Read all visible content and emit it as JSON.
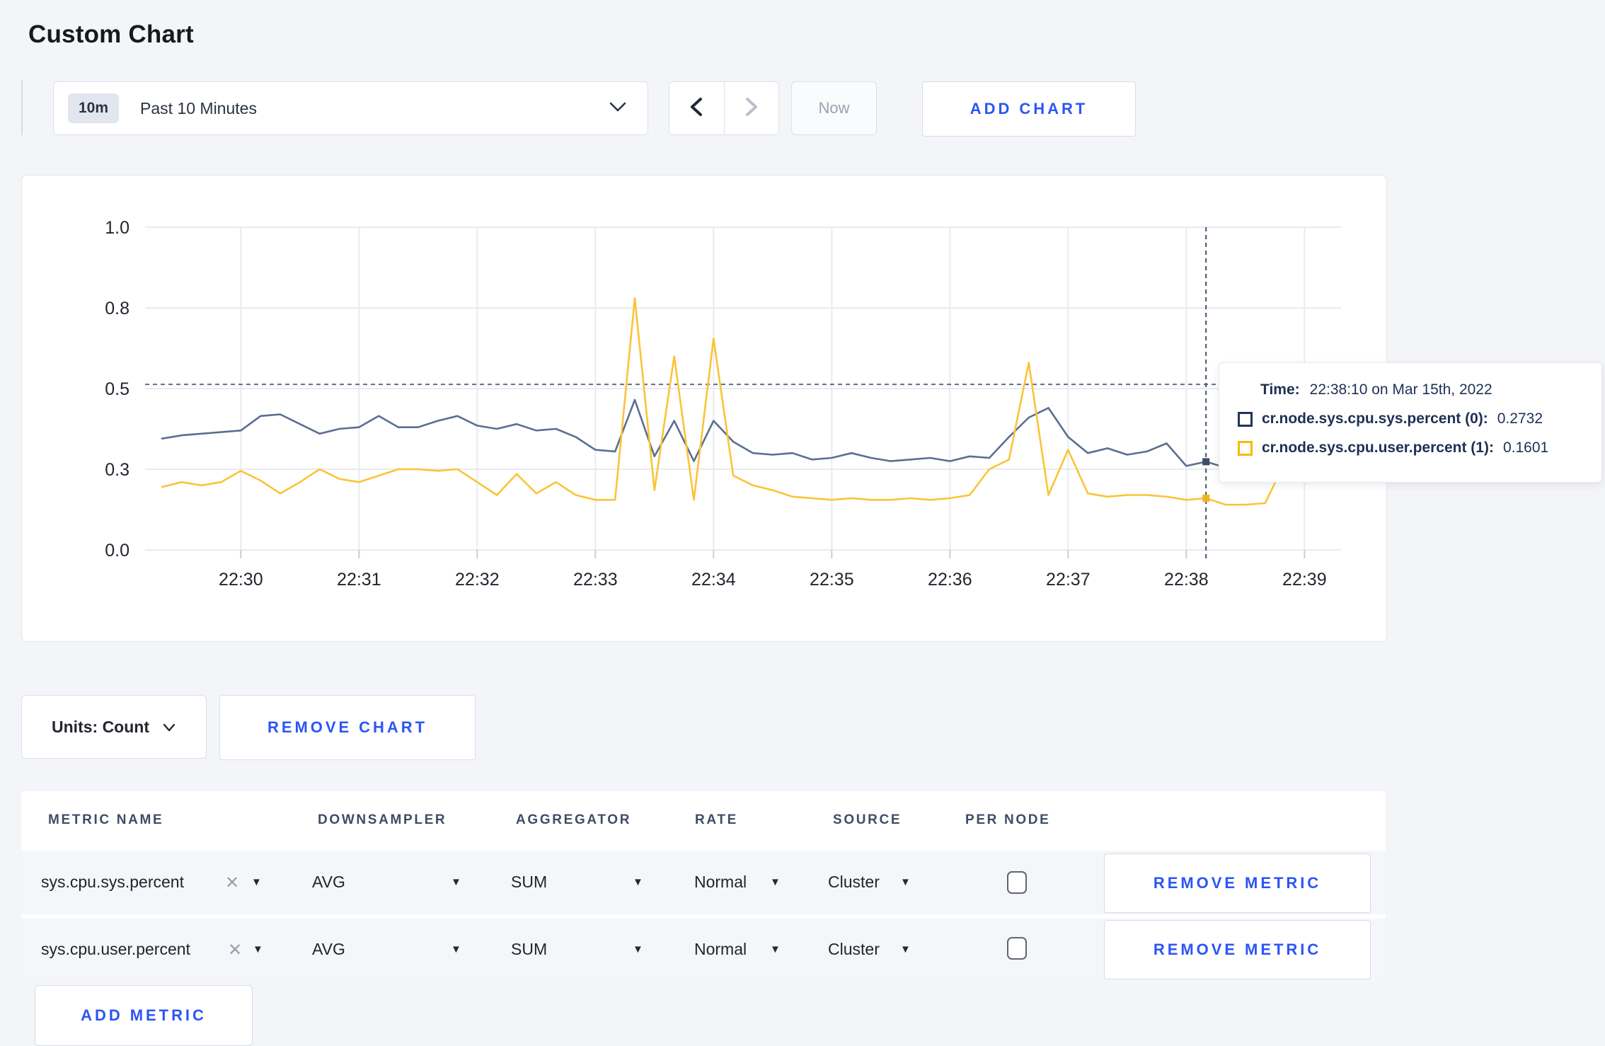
{
  "page": {
    "title": "Custom Chart"
  },
  "toolbar": {
    "time_badge": "10m",
    "time_label": "Past 10 Minutes",
    "now_label": "Now",
    "add_chart_label": "ADD CHART",
    "accent_color": "#2b55f6"
  },
  "chart_controls": {
    "units_label": "Units: Count",
    "remove_chart_label": "REMOVE CHART"
  },
  "metrics_table": {
    "headers": [
      "METRIC NAME",
      "DOWNSAMPLER",
      "AGGREGATOR",
      "RATE",
      "SOURCE",
      "PER NODE"
    ],
    "remove_metric_label": "REMOVE METRIC",
    "add_metric_label": "ADD METRIC",
    "remove_icon": "✕",
    "caret_icon": "▼",
    "rows": [
      {
        "metric": "sys.cpu.sys.percent",
        "downsampler": "AVG",
        "aggregator": "SUM",
        "rate": "Normal",
        "source": "Cluster",
        "per_node_checked": false
      },
      {
        "metric": "sys.cpu.user.percent",
        "downsampler": "AVG",
        "aggregator": "SUM",
        "rate": "Normal",
        "source": "Cluster",
        "per_node_checked": false
      }
    ]
  },
  "chart_data": {
    "type": "line",
    "title": "",
    "xlabel": "",
    "ylabel": "",
    "ylim": [
      0,
      1
    ],
    "grid": true,
    "x_start_time": "22:29:20",
    "x_interval_seconds": 10,
    "x_tick_labels": [
      "22:30",
      "22:31",
      "22:32",
      "22:33",
      "22:34",
      "22:35",
      "22:36",
      "22:37",
      "22:38",
      "22:39"
    ],
    "y_tick_labels": [
      "0.0",
      "0.3",
      "0.5",
      "0.8",
      "1.0"
    ],
    "y_tick_values": [
      0,
      0.25,
      0.5,
      0.75,
      1
    ],
    "series": [
      {
        "name": "cr.node.sys.cpu.sys.percent",
        "color": "#5b6e91",
        "dot_color": "#3d4d66",
        "values": [
          0.345,
          0.355,
          0.36,
          0.365,
          0.37,
          0.415,
          0.42,
          0.39,
          0.36,
          0.375,
          0.38,
          0.415,
          0.38,
          0.38,
          0.4,
          0.415,
          0.385,
          0.375,
          0.39,
          0.37,
          0.375,
          0.35,
          0.31,
          0.305,
          0.465,
          0.29,
          0.4,
          0.275,
          0.4,
          0.335,
          0.3,
          0.295,
          0.3,
          0.28,
          0.285,
          0.3,
          0.285,
          0.275,
          0.28,
          0.285,
          0.275,
          0.29,
          0.285,
          0.35,
          0.41,
          0.44,
          0.35,
          0.3,
          0.315,
          0.295,
          0.305,
          0.33,
          0.26,
          0.2732,
          0.255,
          0.26,
          0.27,
          0.28,
          0.285,
          0.28
        ]
      },
      {
        "name": "cr.node.sys.cpu.user.percent",
        "color": "#fbc437",
        "dot_color": "#f2b31d",
        "values": [
          0.195,
          0.21,
          0.2,
          0.21,
          0.245,
          0.215,
          0.175,
          0.21,
          0.25,
          0.22,
          0.21,
          0.23,
          0.25,
          0.25,
          0.245,
          0.25,
          0.21,
          0.17,
          0.235,
          0.175,
          0.21,
          0.17,
          0.155,
          0.155,
          0.78,
          0.185,
          0.6,
          0.155,
          0.655,
          0.23,
          0.2,
          0.185,
          0.165,
          0.16,
          0.155,
          0.16,
          0.155,
          0.155,
          0.16,
          0.155,
          0.16,
          0.17,
          0.25,
          0.28,
          0.58,
          0.17,
          0.31,
          0.175,
          0.165,
          0.17,
          0.17,
          0.165,
          0.155,
          0.1601,
          0.14,
          0.14,
          0.145,
          0.27,
          0.275,
          0.22
        ]
      }
    ],
    "crosshair": {
      "index": 53,
      "time": "22:38:10",
      "hline_value": 0.513
    },
    "tooltip": {
      "time_label": "Time:",
      "time_value": "22:38:10 on Mar 15th, 2022",
      "entries": [
        {
          "label": "cr.node.sys.cpu.sys.percent (0):",
          "value": "0.2732",
          "color": "#22345a"
        },
        {
          "label": "cr.node.sys.cpu.user.percent (1):",
          "value": "0.1601",
          "color": "#f8b906"
        }
      ]
    }
  }
}
